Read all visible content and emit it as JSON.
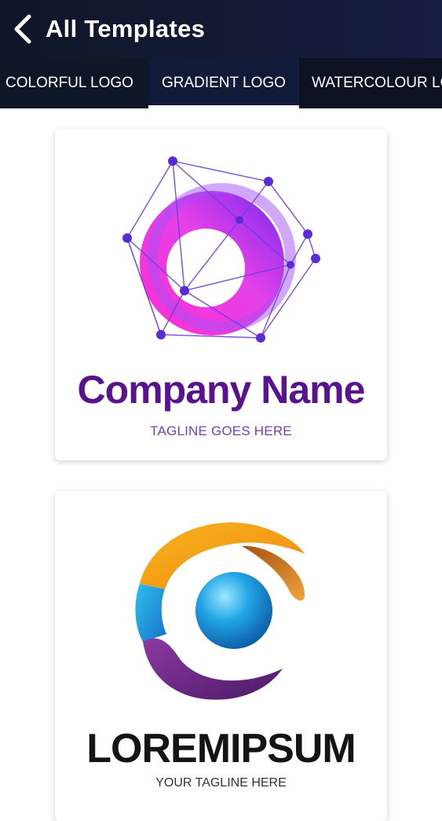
{
  "header": {
    "title": "All Templates"
  },
  "tabs": [
    "COLORFUL LOGO",
    "GRADIENT LOGO",
    "WATERCOLOUR LOGO"
  ],
  "active_tab": "GRADIENT LOGO",
  "templates": [
    {
      "company": "Company Name",
      "tagline": "TAGLINE GOES HERE"
    },
    {
      "company": "LOREMIPSUM",
      "tagline": "YOUR TAGLINE HERE"
    }
  ],
  "colors": {
    "header_bg": "#0f1628",
    "accent_purple": "#5a138f",
    "gradient_start": "#ff2bd0",
    "gradient_end": "#7b2df2"
  },
  "icons": [
    "chevron-left-icon",
    "network-ring-logo",
    "globe-swirl-logo"
  ]
}
